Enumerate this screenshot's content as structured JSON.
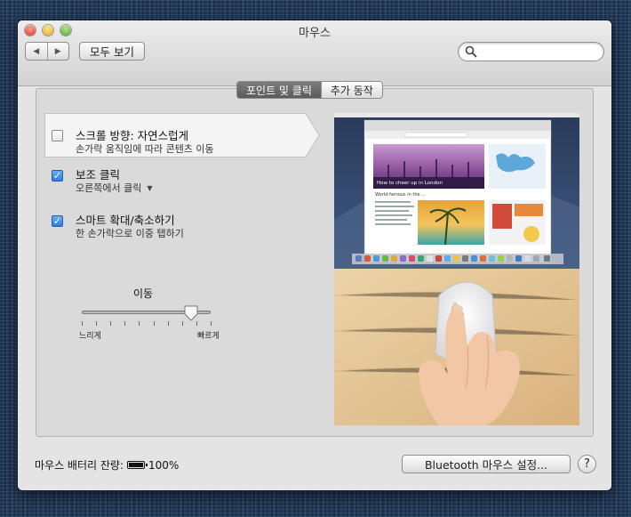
{
  "window": {
    "title": "마우스"
  },
  "toolbar": {
    "show_all_label": "모두 보기",
    "search_placeholder": ""
  },
  "tabs": [
    {
      "label": "포인트 및 클릭",
      "active": true
    },
    {
      "label": "추가 동작",
      "active": false
    }
  ],
  "options": [
    {
      "title": "스크롤 방향: 자연스럽게",
      "description": "손가락 움직임에 따라 콘텐츠 이동",
      "checked": false
    },
    {
      "title": "보조 클릭",
      "description": "오른쪽에서 클릭",
      "checked": true,
      "has_dropdown": true
    },
    {
      "title": "스마트 확대/축소하기",
      "description": "한 손가락으로 이중 탭하기",
      "checked": true
    }
  ],
  "tracking": {
    "label": "이동",
    "min_label": "느리게",
    "max_label": "빠르게",
    "value_fraction": 0.85
  },
  "preview": {
    "headline": "How to cheer up in London",
    "article": "World-famous in the ..."
  },
  "footer": {
    "battery_label": "마우스 배터리 잔량:",
    "battery_value": "100%",
    "bluetooth_button": "Bluetooth 마우스 설정...",
    "help_label": "?"
  }
}
